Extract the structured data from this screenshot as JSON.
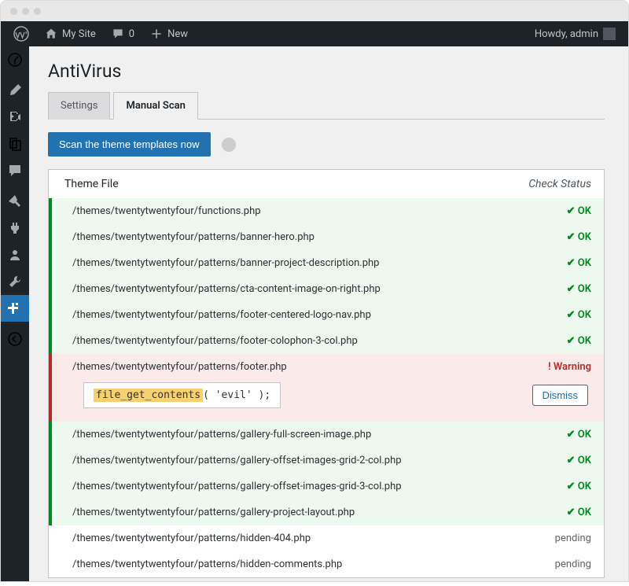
{
  "topbar": {
    "site_name": "My Site",
    "comments_count": "0",
    "new_label": "New",
    "greeting": "Howdy, admin"
  },
  "sidebar": {
    "items": [
      {
        "name": "dashboard-icon"
      },
      {
        "name": "pin-icon"
      },
      {
        "name": "media-icon"
      },
      {
        "name": "pages-icon"
      },
      {
        "name": "comments-icon"
      },
      {
        "name": "appearance-icon"
      },
      {
        "name": "plugins-icon"
      },
      {
        "name": "users-icon"
      },
      {
        "name": "tools-icon"
      },
      {
        "name": "settings-icon"
      },
      {
        "name": "collapse-icon"
      }
    ]
  },
  "page": {
    "title": "AntiVirus",
    "tabs": [
      {
        "label": "Settings",
        "active": false
      },
      {
        "label": "Manual Scan",
        "active": true
      }
    ],
    "scan_button": "Scan the theme templates now",
    "table": {
      "header_file": "Theme File",
      "header_status": "Check Status",
      "ok_label": "✔ OK",
      "warning_label": "! Warning",
      "pending_label": "pending",
      "dismiss_label": "Dismiss",
      "code_highlight": "file_get_contents",
      "code_rest": "( 'evil' );",
      "rows": [
        {
          "file": "/themes/twentytwentyfour/functions.php",
          "status": "ok"
        },
        {
          "file": "/themes/twentytwentyfour/patterns/banner-hero.php",
          "status": "ok"
        },
        {
          "file": "/themes/twentytwentyfour/patterns/banner-project-description.php",
          "status": "ok"
        },
        {
          "file": "/themes/twentytwentyfour/patterns/cta-content-image-on-right.php",
          "status": "ok"
        },
        {
          "file": "/themes/twentytwentyfour/patterns/footer-centered-logo-nav.php",
          "status": "ok"
        },
        {
          "file": "/themes/twentytwentyfour/patterns/footer-colophon-3-col.php",
          "status": "ok"
        },
        {
          "file": "/themes/twentytwentyfour/patterns/footer.php",
          "status": "warning"
        },
        {
          "file": "/themes/twentytwentyfour/patterns/gallery-full-screen-image.php",
          "status": "ok"
        },
        {
          "file": "/themes/twentytwentyfour/patterns/gallery-offset-images-grid-2-col.php",
          "status": "ok"
        },
        {
          "file": "/themes/twentytwentyfour/patterns/gallery-offset-images-grid-3-col.php",
          "status": "ok"
        },
        {
          "file": "/themes/twentytwentyfour/patterns/gallery-project-layout.php",
          "status": "ok"
        },
        {
          "file": "/themes/twentytwentyfour/patterns/hidden-404.php",
          "status": "pending"
        },
        {
          "file": "/themes/twentytwentyfour/patterns/hidden-comments.php",
          "status": "pending"
        }
      ]
    }
  }
}
